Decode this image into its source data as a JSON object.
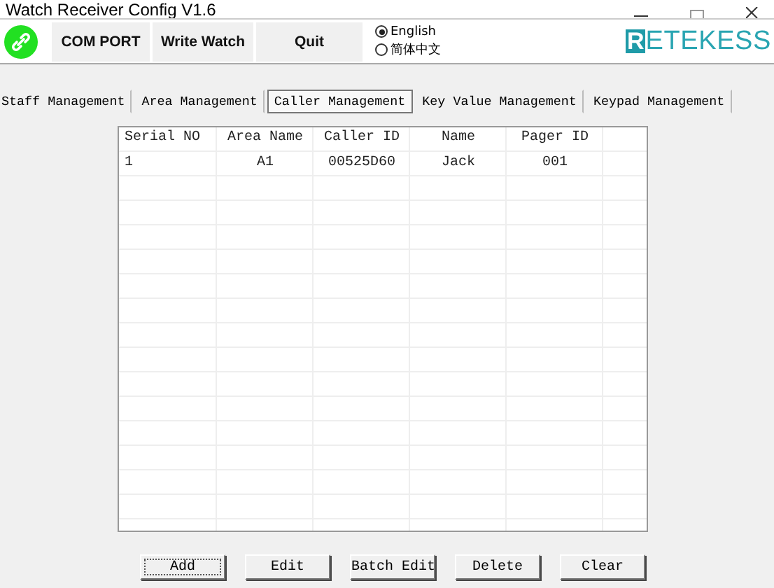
{
  "window": {
    "title": "Watch Receiver Config V1.6"
  },
  "toolbar": {
    "buttons": [
      "COM PORT",
      "Write Watch",
      "Quit"
    ],
    "languages": [
      {
        "label": "English",
        "selected": true
      },
      {
        "label": "简体中文",
        "selected": false
      }
    ],
    "logo": {
      "mark": "R",
      "text": "ETEKESS"
    }
  },
  "tabs": [
    {
      "label": "Staff Management",
      "selected": false
    },
    {
      "label": "Area Management",
      "selected": false
    },
    {
      "label": "Caller Management",
      "selected": true
    },
    {
      "label": "Key Value Management",
      "selected": false
    },
    {
      "label": "Keypad Management",
      "selected": false
    }
  ],
  "table": {
    "columns": [
      "Serial NO",
      "Area Name",
      "Caller ID",
      "Name",
      "Pager ID"
    ],
    "rows": [
      [
        "1",
        "A1",
        "00525D60",
        "Jack",
        "001"
      ]
    ]
  },
  "buttons": [
    {
      "label": "Add",
      "focused": true
    },
    {
      "label": "Edit",
      "focused": false
    },
    {
      "label": "Batch Edit",
      "focused": false
    },
    {
      "label": "Delete",
      "focused": false
    },
    {
      "label": "Clear",
      "focused": false
    }
  ]
}
